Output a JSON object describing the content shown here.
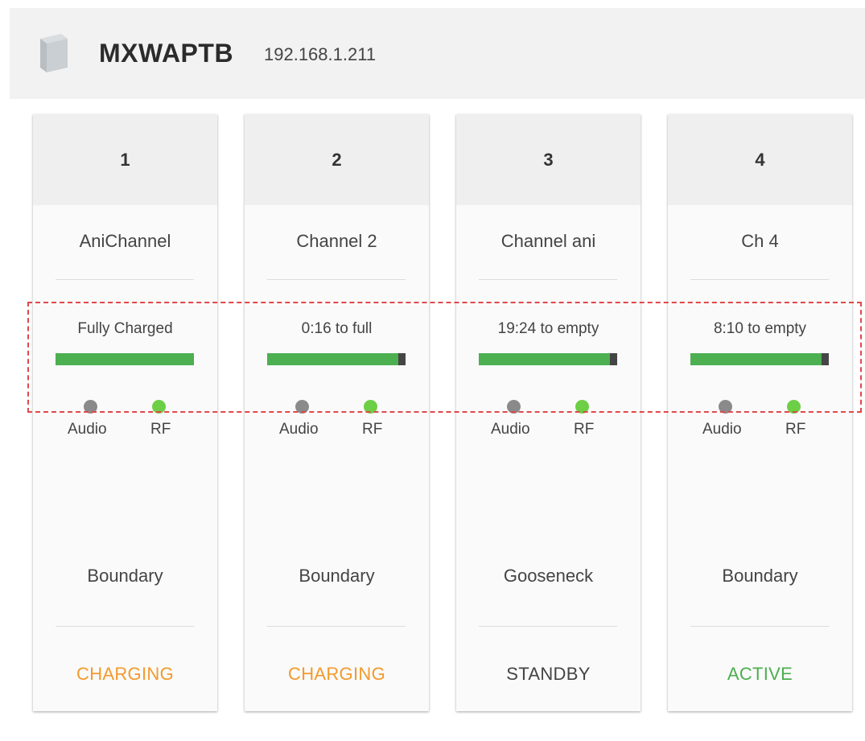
{
  "device": {
    "name": "MXWAPTB",
    "ip": "192.168.1.211",
    "icon": "access-point-icon"
  },
  "labels": {
    "audio": "Audio",
    "rf": "RF"
  },
  "colors": {
    "charging": "#f39a2c",
    "standby": "#444444",
    "active": "#4caf50",
    "battery_fill": "#4caf50",
    "rf_on": "#6ccf45",
    "audio_off": "#8a8a8a",
    "highlight": "#e0484a"
  },
  "channels": [
    {
      "number": "1",
      "name": "AniChannel",
      "battery_text": "Fully Charged",
      "battery_level": 1.0,
      "audio_active": false,
      "rf_active": true,
      "mic_type": "Boundary",
      "state": "CHARGING"
    },
    {
      "number": "2",
      "name": "Channel 2",
      "battery_text": "0:16 to full",
      "battery_level": 0.95,
      "audio_active": false,
      "rf_active": true,
      "mic_type": "Boundary",
      "state": "CHARGING"
    },
    {
      "number": "3",
      "name": "Channel ani",
      "battery_text": "19:24 to empty",
      "battery_level": 0.95,
      "audio_active": false,
      "rf_active": true,
      "mic_type": "Gooseneck",
      "state": "STANDBY"
    },
    {
      "number": "4",
      "name": "Ch 4",
      "battery_text": "8:10 to empty",
      "battery_level": 0.95,
      "audio_active": false,
      "rf_active": true,
      "mic_type": "Boundary",
      "state": "ACTIVE"
    }
  ]
}
